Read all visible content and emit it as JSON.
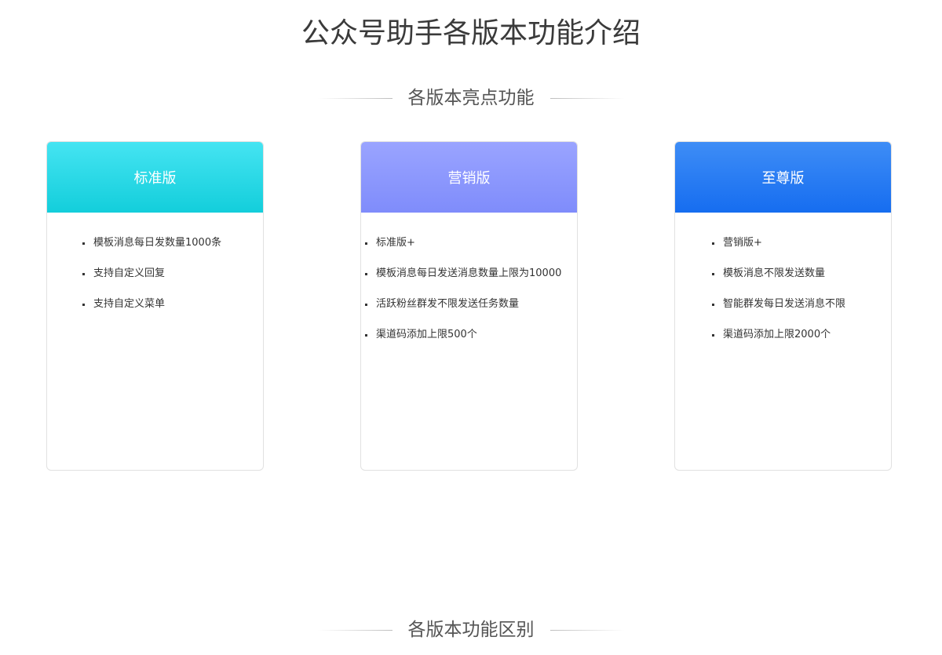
{
  "page": {
    "title": "公众号助手各版本功能介绍"
  },
  "sections": {
    "highlights": "各版本亮点功能",
    "differences": "各版本功能区别"
  },
  "colors": {
    "standard_gradient": [
      "#45e4f2",
      "#13cedb"
    ],
    "marketing_gradient": [
      "#9aa4ff",
      "#7f8cfb"
    ],
    "premium_gradient": [
      "#3e8df6",
      "#166df0"
    ]
  },
  "cards": [
    {
      "name": "标准版",
      "features": [
        "模板消息每日发数量1000条",
        "支持自定义回复",
        "支持自定义菜单"
      ]
    },
    {
      "name": "营销版",
      "features": [
        "标准版+",
        "模板消息每日发送消息数量上限为10000",
        "活跃粉丝群发不限发送任务数量",
        "渠道码添加上限500个"
      ]
    },
    {
      "name": "至尊版",
      "features": [
        "营销版+",
        "模板消息不限发送数量",
        "智能群发每日发送消息不限",
        "渠道码添加上限2000个"
      ]
    }
  ]
}
